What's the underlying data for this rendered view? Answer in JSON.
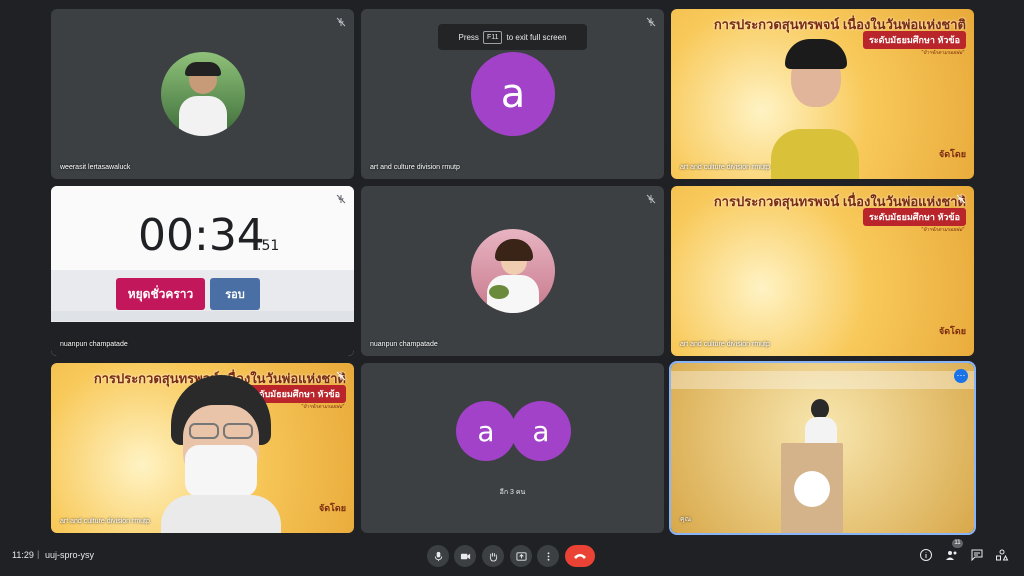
{
  "toast": {
    "press": "Press",
    "key": "F11",
    "suffix": "to exit full screen"
  },
  "tiles": [
    {
      "name": "weerasit lertasawaluck"
    },
    {
      "name": "art and culture division rmutp",
      "letter": "a"
    },
    {
      "name": "art and culture division rmutp"
    },
    {
      "name": "nuanpun champatade"
    },
    {
      "name": "nuanpun champatade"
    },
    {
      "name": "art and culture division rmutp"
    },
    {
      "name": "art and culture division rmutp"
    },
    {
      "name": "อีก 3 คน",
      "letters": [
        "a",
        "a"
      ]
    },
    {
      "name": "คุณ"
    }
  ],
  "slide": {
    "title": "การประกวดสุนทรพจน์ เนื่องในวันพ่อแห่งชาติ",
    "pill": "ระดับมัธยมศึกษา หัวข้อ",
    "sub": "\"ข้าฯจักตามรอยพ่อ\"",
    "corner": "จัดโดย"
  },
  "timer": {
    "time": "00:34",
    "fraction": ".51",
    "stop_btn": "หยุดชั่วคราว",
    "lap_btn": "รอบ"
  },
  "bottom": {
    "time": "11:29",
    "code": "uuj-spro-ysy",
    "people_count": "11"
  }
}
